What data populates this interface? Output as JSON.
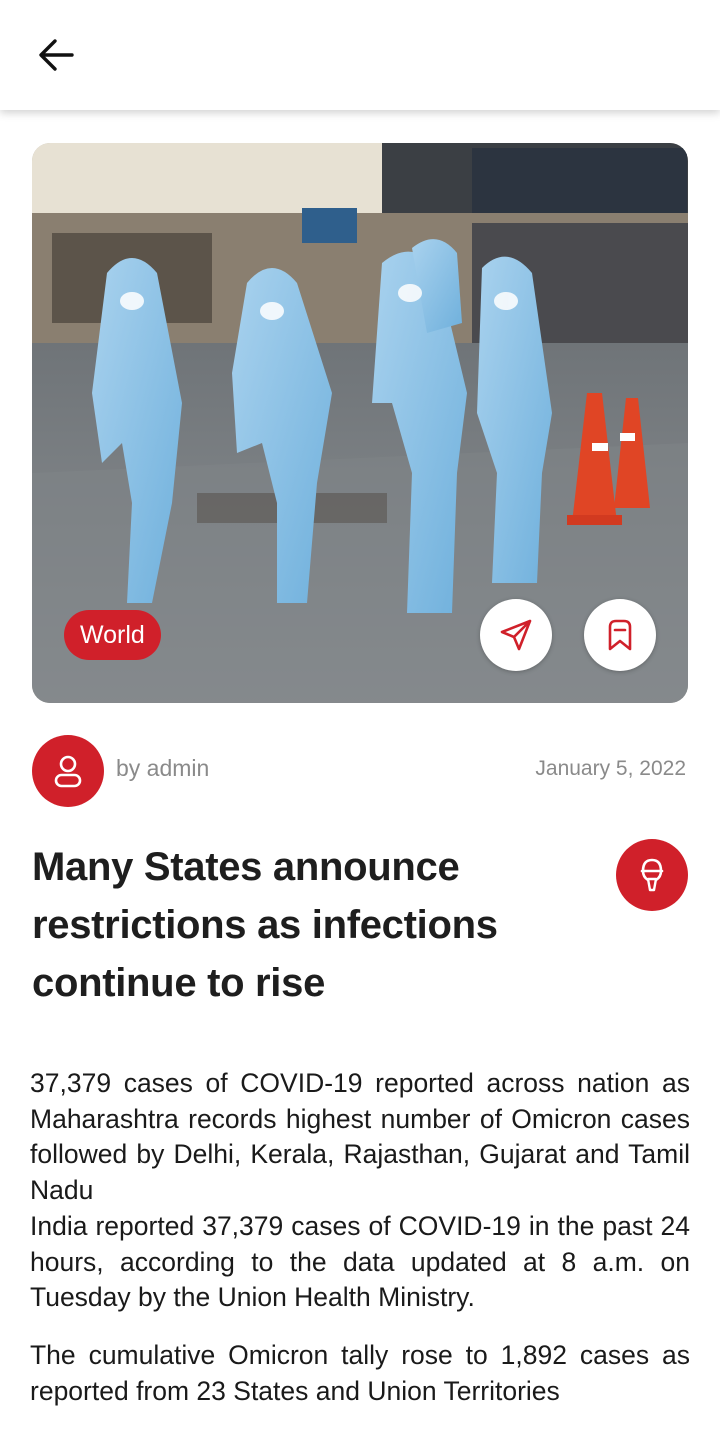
{
  "header": {
    "back_icon": "arrow-left-icon"
  },
  "hero": {
    "category": "World",
    "share_icon": "send-icon",
    "bookmark_icon": "bookmark-icon"
  },
  "meta": {
    "author": "by admin",
    "date": "January 5, 2022",
    "avatar_icon": "user-icon"
  },
  "article": {
    "title": "Many States announce restrictions as infections continue to rise",
    "listen_icon": "podcast-icon",
    "paragraphs": [
      "37,379 cases of COVID-19 reported across nation as Maharashtra records highest number of Omicron cases followed by Delhi, Kerala, Rajasthan, Gujarat and Tamil Nadu",
      "India reported 37,379 cases of COVID-19 in the past 24 hours, according to the data updated at 8 a.m. on Tuesday by the Union Health Ministry.",
      "The cumulative Omicron tally rose to 1,892 cases as reported from 23 States and Union Territories"
    ]
  },
  "colors": {
    "accent": "#d0202a",
    "muted": "#8a8a8a",
    "text": "#1e1e1e"
  }
}
